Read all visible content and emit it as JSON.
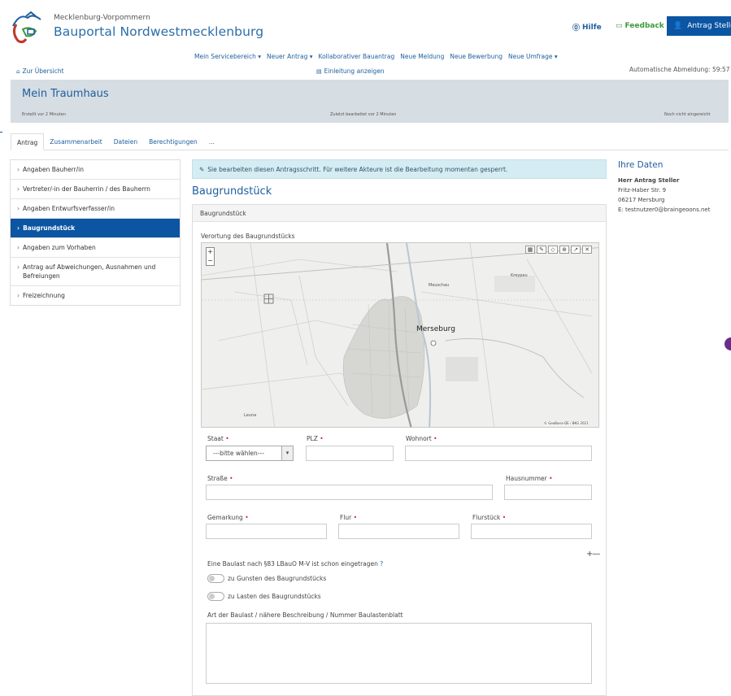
{
  "brand": {
    "subtitle": "Mecklenburg-Vorpommern",
    "title": "Bauportal Nordwestmecklenburg"
  },
  "header": {
    "help": "Hilfe",
    "feedback": "Feedback",
    "user": "Antrag Steller"
  },
  "topnav": [
    "Mein Servicebereich ▾",
    "Neuer Antrag ▾",
    "Kollaborativer Bauantrag",
    "Neue Meldung",
    "Neue Bewerbung",
    "Neue Umfrage ▾"
  ],
  "subnav": {
    "back": "Zur Übersicht",
    "intro": "Einleitung anzeigen",
    "logout": "Automatische Abmeldung: 59:57"
  },
  "project": {
    "title": "Mein Traumhaus",
    "created": "Erstellt vor 2 Minuten",
    "edited": "Zuletzt bearbeitet vor 2 Minuten",
    "submitted": "Noch nicht eingereicht"
  },
  "tabs": [
    "Antrag",
    "Zusammenarbeit",
    "Dateien",
    "Berechtigungen",
    "..."
  ],
  "sidenav": [
    "Angaben Bauherr/in",
    "Vertreter/-in der Bauherrin / des Bauherrn",
    "Angaben Entwurfsverfasser/in",
    "Baugrundstück",
    "Angaben zum Vorhaben",
    "Antrag auf Abweichungen, Ausnahmen und Befreiungen",
    "Freizeichnung"
  ],
  "alert": "Sie bearbeiten diesen Antragsschritt. Für weitere Akteure ist die Bearbeitung momentan gesperrt.",
  "section": {
    "title": "Baugrundstück",
    "panel": "Baugrundstück",
    "map_label": "Verortung des Baugrundstücks"
  },
  "map": {
    "city": "Merseburg",
    "places": [
      "Meuschau",
      "Kreypau",
      "Leuna"
    ],
    "credit": "© GeoBasis-DE / BKG 2021"
  },
  "form": {
    "staat": "Staat",
    "staat_value": "---bitte wählen---",
    "plz": "PLZ",
    "wohnort": "Wohnort",
    "strasse": "Straße",
    "hausnummer": "Hausnummer",
    "gemarkung": "Gemarkung",
    "flur": "Flur",
    "flurstueck": "Flurstück",
    "baulast_q": "Eine Baulast nach §83 LBauO M-V ist schon eingetragen",
    "toggle1": "zu Gunsten des Baugrundstücks",
    "toggle2": "zu Lasten des Baugrundstücks",
    "art": "Art der Baulast / nähere Beschreibung / Nummer Baulastenblatt"
  },
  "side": {
    "title": "Ihre Daten",
    "name": "Herr Antrag Steller",
    "street": "Fritz-Haber Str. 9",
    "city": "06217 Mersburg",
    "email": "E: testnutzer0@braingeoons.net"
  },
  "colors": {
    "primary": "#0b55a3",
    "link": "#1d5f9e",
    "feedback": "#3c9a3c",
    "alert_bg": "#d5ecf3",
    "band": "#d6dde3",
    "required": "#d0252b"
  }
}
